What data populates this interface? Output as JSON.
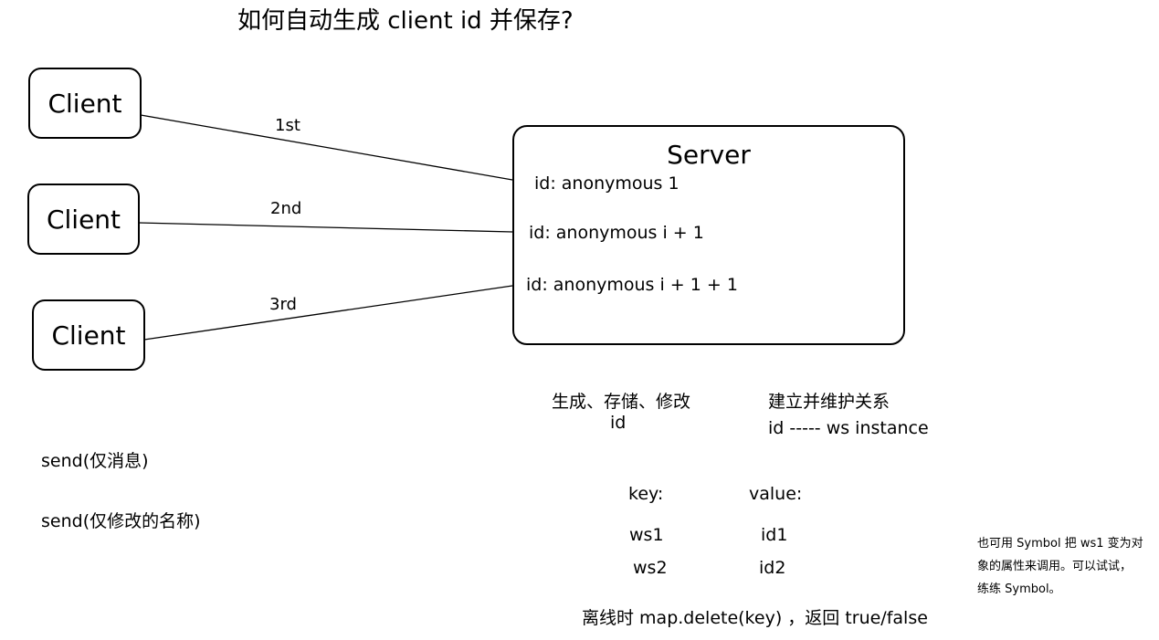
{
  "title": "如何自动生成 client id 并保存?",
  "clients": [
    {
      "label": "Client"
    },
    {
      "label": "Client"
    },
    {
      "label": "Client"
    }
  ],
  "edges": [
    {
      "label": "1st"
    },
    {
      "label": "2nd"
    },
    {
      "label": "3rd"
    }
  ],
  "server": {
    "title": "Server",
    "lines": [
      "id: anonymous 1",
      "id: anonymous i + 1",
      "id: anonymous i + 1 + 1"
    ]
  },
  "notes": {
    "generate_line1": "生成、存储、修改",
    "generate_line2": "id",
    "relation_line1": "建立并维护关系",
    "relation_line2": "id ----- ws instance",
    "send1": "send(仅消息)",
    "send2": "send(仅修改的名称)",
    "key_header": "key:",
    "value_header": "value:",
    "map_rows": [
      {
        "key": "ws1",
        "value": "id1"
      },
      {
        "key": "ws2",
        "value": "id2"
      }
    ],
    "offline": "离线时 map.delete(key) ，返回 true/false",
    "symbol_note": [
      "也可用 Symbol 把 ws1 变为对",
      "象的属性来调用。可以试试，",
      "练练 Symbol。"
    ]
  }
}
